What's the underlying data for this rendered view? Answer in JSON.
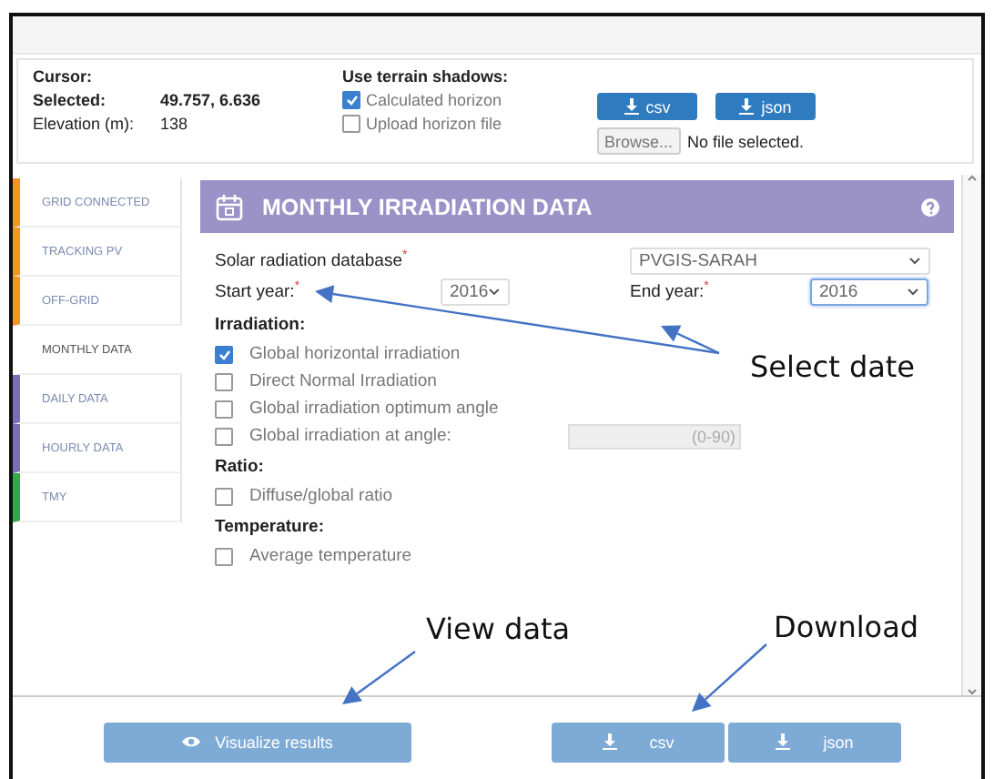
{
  "info": {
    "cursor_label": "Cursor:",
    "selected_label": "Selected:",
    "selected_value": "49.757, 6.636",
    "elevation_label": "Elevation (m):",
    "elevation_value": "138",
    "shadows_label": "Use terrain shadows:",
    "options": [
      {
        "label": "Calculated horizon",
        "checked": true
      },
      {
        "label": "Upload horizon file",
        "checked": false
      }
    ],
    "download_buttons": [
      "csv",
      "json"
    ],
    "browse_button": "Browse...",
    "file_status": "No file selected."
  },
  "sidebar": {
    "items": [
      {
        "label": "GRID CONNECTED",
        "color": "#f7941d",
        "selected": false
      },
      {
        "label": "TRACKING PV",
        "color": "#f7941d",
        "selected": false
      },
      {
        "label": "OFF-GRID",
        "color": "#f7941d",
        "selected": false
      },
      {
        "label": "MONTHLY DATA",
        "color": "#ffffff",
        "selected": true
      },
      {
        "label": "DAILY DATA",
        "color": "#7b6cb4",
        "selected": false
      },
      {
        "label": "HOURLY DATA",
        "color": "#7b6cb4",
        "selected": false
      },
      {
        "label": "TMY",
        "color": "#2eaa4a",
        "selected": false
      }
    ]
  },
  "panel": {
    "title": "MONTHLY IRRADIATION DATA",
    "database": {
      "label": "Solar radiation database",
      "required_mark": "*",
      "value": "PVGIS-SARAH"
    },
    "start_year": {
      "label": "Start year:",
      "required_mark": "*",
      "value": "2016",
      "focused": false
    },
    "end_year": {
      "label": "End year:",
      "required_mark": "*",
      "value": "2016",
      "focused": true
    },
    "sections": [
      {
        "heading": "Irradiation:",
        "options": [
          {
            "label": "Global horizontal irradiation",
            "checked": true
          },
          {
            "label": "Direct Normal Irradiation",
            "checked": false
          },
          {
            "label": "Global irradiation optimum angle",
            "checked": false
          },
          {
            "label": "Global irradiation at angle:",
            "checked": false,
            "placeholder": "(0-90)"
          }
        ]
      },
      {
        "heading": "Ratio:",
        "options": [
          {
            "label": "Diffuse/global ratio",
            "checked": false
          }
        ]
      },
      {
        "heading": "Temperature:",
        "options": [
          {
            "label": "Average temperature",
            "checked": false
          }
        ]
      }
    ]
  },
  "bottom": {
    "visualize": {
      "label": "Visualize results",
      "disabled": true
    },
    "downloads": [
      {
        "label": "csv",
        "disabled": true
      },
      {
        "label": "json",
        "disabled": true
      }
    ]
  },
  "annotations": [
    {
      "text": "Select date"
    },
    {
      "text": "View data"
    },
    {
      "text": "Download"
    }
  ]
}
